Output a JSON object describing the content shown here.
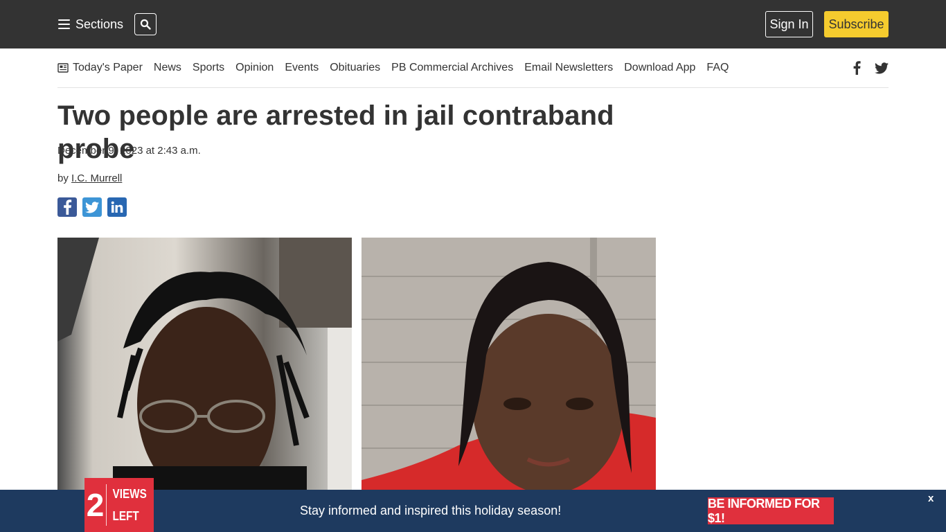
{
  "header": {
    "sections_label": "Sections",
    "signin_label": "Sign In",
    "subscribe_label": "Subscribe",
    "subscribe_color": "#f5cb2e",
    "bar_color": "#333333"
  },
  "nav": {
    "items": [
      {
        "label": "Today's Paper",
        "icon": "newspaper-icon"
      },
      {
        "label": "News"
      },
      {
        "label": "Sports"
      },
      {
        "label": "Opinion"
      },
      {
        "label": "Events"
      },
      {
        "label": "Obituaries"
      },
      {
        "label": "PB Commercial Archives"
      },
      {
        "label": "Email Newsletters"
      },
      {
        "label": "Download App"
      },
      {
        "label": "FAQ"
      }
    ],
    "social": [
      "facebook-icon",
      "twitter-icon"
    ]
  },
  "article": {
    "headline": "Two people are arrested in jail contraband probe",
    "date": "December 9, 2023 at 2:43 a.m.",
    "by_prefix": "by",
    "author": "I.C. Murrell",
    "share": [
      {
        "icon": "facebook-icon",
        "color": "#3b5998"
      },
      {
        "icon": "twitter-icon",
        "color": "#3d95d6"
      },
      {
        "icon": "linkedin-icon",
        "color": "#2867b2"
      }
    ]
  },
  "banner": {
    "views_count": "2",
    "views_line1": "VIEWS",
    "views_line2": "LEFT",
    "message": "Stay informed and inspired this holiday season!",
    "cta_label": "BE INFORMED FOR $1!",
    "close_label": "x",
    "bg_color": "#1e3a5f",
    "accent_color": "#e0303d"
  }
}
